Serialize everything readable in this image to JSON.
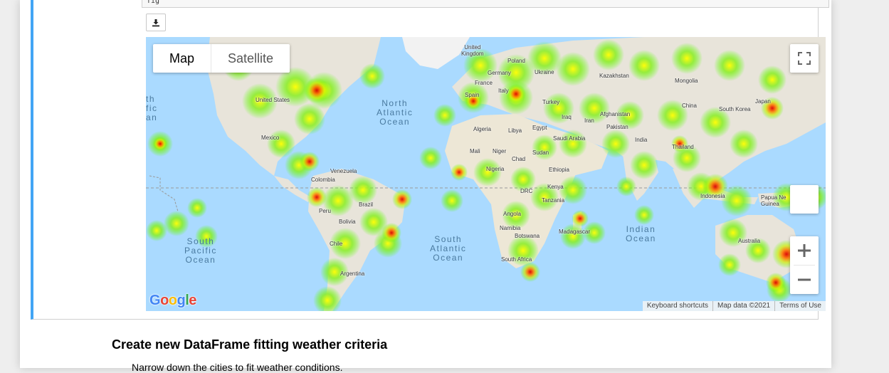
{
  "code_stub_text": "fig",
  "download_button": {
    "icon": "download-icon"
  },
  "map": {
    "type_control": {
      "map_label": "Map",
      "satellite_label": "Satellite",
      "selected": "Map"
    },
    "fullscreen": {
      "icon": "fullscreen-icon"
    },
    "zoom": {
      "in_icon": "plus-icon",
      "out_icon": "minus-icon"
    },
    "attribution": {
      "shortcuts": "Keyboard shortcuts",
      "data": "Map data ©2021",
      "terms": "Terms of Use"
    },
    "logo_text": "Google",
    "oceans": {
      "north_atlantic": "North\nAtlantic\nOcean",
      "south_atlantic": "South\nAtlantic\nOcean",
      "south_pacific": "South\nPacific\nOcean",
      "indian": "Indian\nOcean",
      "north_pacific_partial": "th\nfic\nan"
    },
    "places": {
      "united_kingdom": "United\nKingdom",
      "poland": "Poland",
      "ukraine": "Ukraine",
      "germany": "Germany",
      "france": "France",
      "italy": "Italy",
      "spain": "Spain",
      "kazakhstan": "Kazakhstan",
      "mongolia": "Mongolia",
      "china": "China",
      "south_korea": "South Korea",
      "japan": "Japan",
      "turkey": "Turkey",
      "iraq": "Iraq",
      "iran": "Iran",
      "afghanistan": "Afghanistan",
      "pakistan": "Pakistan",
      "india": "India",
      "thailand": "Thailand",
      "indonesia": "Indonesia",
      "papua": "Papua Ne\nGuinea",
      "australia": "Australia",
      "algeria": "Algeria",
      "libya": "Libya",
      "egypt": "Egypt",
      "saudi": "Saudi Arabia",
      "mali": "Mali",
      "niger": "Niger",
      "chad": "Chad",
      "sudan": "Sudan",
      "nigeria": "Nigeria",
      "ethiopia": "Ethiopia",
      "drc": "DRC",
      "kenya": "Kenya",
      "tanzania": "Tanzania",
      "angola": "Angola",
      "namibia": "Namibia",
      "botswana": "Botswana",
      "madagascar": "Madagascar",
      "south_africa": "South Africa",
      "united_states": "United States",
      "mexico": "Mexico",
      "venezuela": "Venezuela",
      "colombia": "Colombia",
      "peru": "Peru",
      "brazil": "Brazil",
      "bolivia": "Bolivia",
      "chile": "Chile",
      "argentina": "Argentina"
    }
  },
  "section_heading": "Create new DataFrame fitting weather criteria",
  "section_text": "Narrow down the cities to fit weather conditions."
}
